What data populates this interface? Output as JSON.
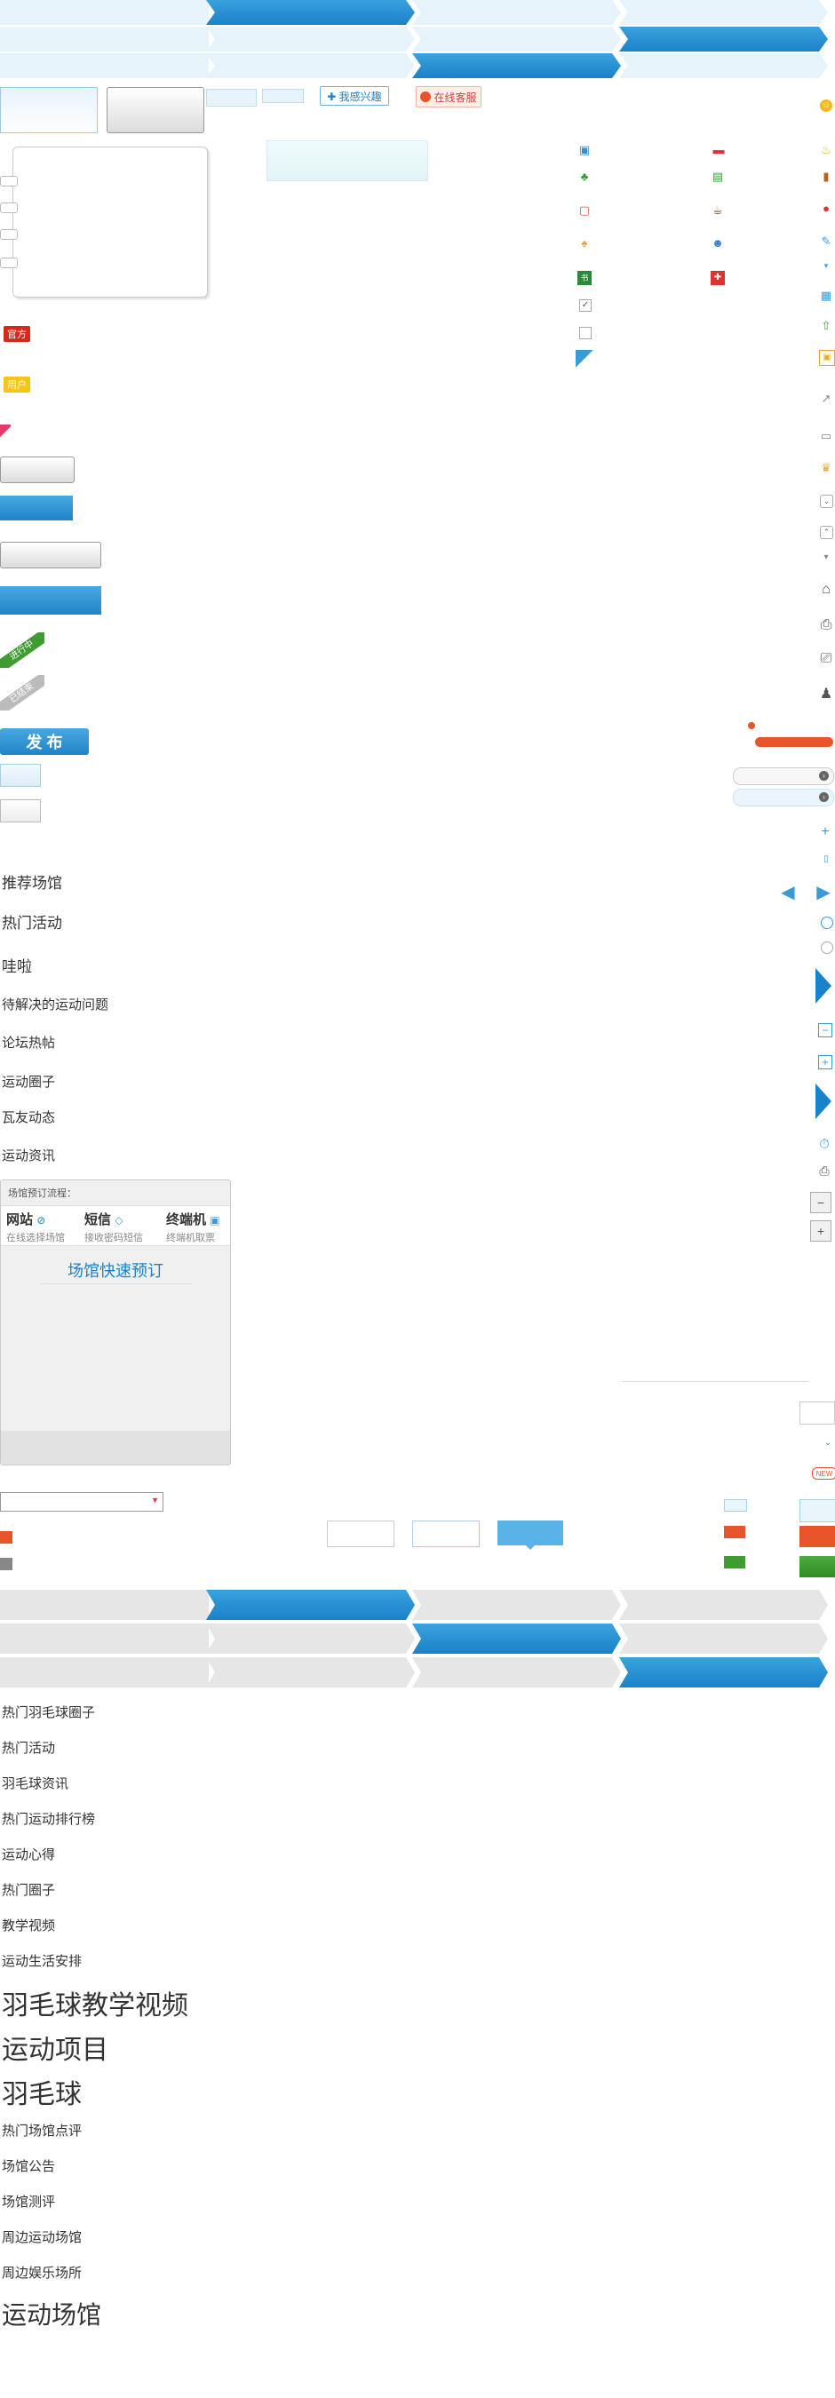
{
  "top_buttons": {
    "interest_label": "✚ 我感兴趣",
    "service_label": "在线客服"
  },
  "tags": {
    "official": "官方",
    "user": "用户",
    "ongoing": "进行中",
    "ended": "已结束",
    "new": "NEW"
  },
  "publish_button": "发 布",
  "section_headings": [
    "推荐场馆",
    "热门活动",
    "哇啦",
    "待解决的运动问题",
    "论坛热帖",
    "运动圈子",
    "瓦友动态",
    "运动资讯"
  ],
  "booking": {
    "title": "场馆预订流程：",
    "steps": [
      {
        "name": "网站",
        "desc": "在线选择场馆"
      },
      {
        "name": "短信",
        "desc": "接收密码短信"
      },
      {
        "name": "终端机",
        "desc": "终端机取票"
      }
    ],
    "quick_label": "场馆快速预订"
  },
  "bottom_headings": [
    "热门羽毛球圈子",
    "热门活动",
    "羽毛球资讯",
    "热门运动排行榜",
    "运动心得",
    "热门圈子",
    "教学视频",
    "运动生活安排"
  ],
  "large_headings": [
    "羽毛球教学视频",
    "运动项目",
    "羽毛球"
  ],
  "venue_headings": [
    "热门场馆点评",
    "场馆公告",
    "场馆测评",
    "周边运动场馆",
    "周边娱乐场所"
  ],
  "venue_large": "运动场馆",
  "icons": {
    "left_grid": [
      "building-icon",
      "car-icon",
      "tree-icon",
      "id-card-icon",
      "bag-icon",
      "coffee-icon",
      "shirt-icon",
      "people-icon",
      "book-icon",
      "tools-icon",
      "checkbox-checked-icon",
      "checkbox-empty-icon",
      "corner-tag-icon"
    ],
    "right_column": [
      "smile-icon",
      "cake-icon",
      "luggage-icon",
      "bag-red-icon",
      "pencil-icon",
      "chevron-down-small-icon",
      "gift-icon",
      "arrow-up-green-icon",
      "image-icon",
      "share-icon",
      "comment-icon",
      "trophy-icon",
      "chevron-down-icon",
      "chevron-up-icon",
      "dot-down-icon",
      "home-icon",
      "ticket-icon",
      "printer-icon",
      "person-icon",
      "plus-blue-icon",
      "doc-icon",
      "arrow-left-icon",
      "arrow-right-icon",
      "circle-icon",
      "circle-gray-icon",
      "play-triangle-icon",
      "minus-box-icon",
      "plus-box-icon",
      "play-triangle-2-icon",
      "clock-icon",
      "printer-2-icon",
      "minus-gray-icon",
      "plus-gray-icon"
    ]
  },
  "colors": {
    "blue": "#1a82c8",
    "light_blue": "#e6f3fb",
    "gray": "#e6e6e6",
    "orange": "#e8542a",
    "green": "#3f9b32",
    "red_tag": "#d9281b",
    "yellow_tag": "#f5c518"
  }
}
